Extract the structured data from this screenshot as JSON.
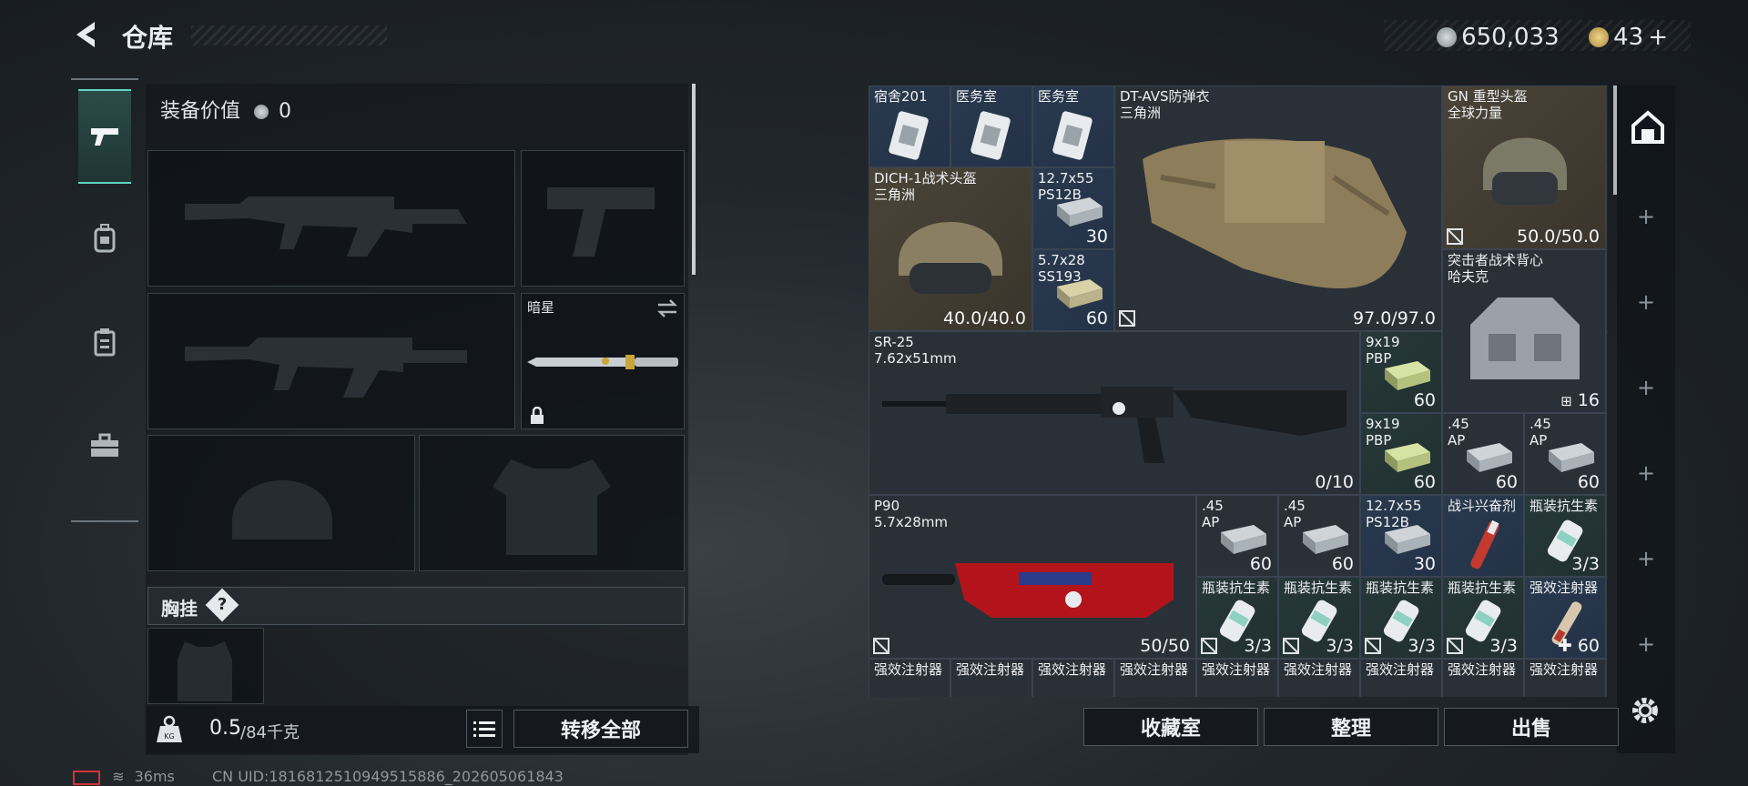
{
  "header": {
    "title": "仓库",
    "currency1_value": "650,033",
    "currency2_value": "43",
    "currency2_add": "+"
  },
  "left_nav": {
    "items": [
      "weapon-icon",
      "backpack-icon",
      "clipboard-icon",
      "toolbox-icon"
    ],
    "active": 0
  },
  "equipment": {
    "value_label": "装备价值",
    "value": "0",
    "melee_name": "暗星",
    "chest_label": "胸挂",
    "chest_help": "?",
    "weight_current": "0.5",
    "weight_max": "/84千克",
    "transfer_all": "转移全部"
  },
  "grid": {
    "items": [
      {
        "name": "宿舍201",
        "sub": "",
        "qty": ""
      },
      {
        "name": "医务室",
        "sub": "",
        "qty": ""
      },
      {
        "name": "医务室",
        "sub": "",
        "qty": ""
      },
      {
        "name": "DT-AVS防弹衣",
        "sub": "三角洲",
        "qty": "97.0/97.0"
      },
      {
        "name": "GN 重型头盔",
        "sub": "全球力量",
        "qty": "50.0/50.0"
      },
      {
        "name": "DICH-1战术头盔",
        "sub": "三角洲",
        "qty": "40.0/40.0"
      },
      {
        "name": "12.7x55",
        "sub": "PS12B",
        "qty": "30"
      },
      {
        "name": "5.7x28",
        "sub": "SS193",
        "qty": "60"
      },
      {
        "name": "突击者战术背心",
        "sub": "哈夫克",
        "qty": "16"
      },
      {
        "name": "SR-25",
        "sub": "7.62x51mm",
        "qty": "0/10"
      },
      {
        "name": "9x19",
        "sub": "PBP",
        "qty": "60"
      },
      {
        "name": "9x19",
        "sub": "PBP",
        "qty": "60"
      },
      {
        "name": ".45",
        "sub": "AP",
        "qty": "60"
      },
      {
        "name": ".45",
        "sub": "AP",
        "qty": "60"
      },
      {
        "name": "P90",
        "sub": "5.7x28mm",
        "qty": "50/50"
      },
      {
        "name": ".45",
        "sub": "AP",
        "qty": "60"
      },
      {
        "name": ".45",
        "sub": "AP",
        "qty": "60"
      },
      {
        "name": "12.7x55",
        "sub": "PS12B",
        "qty": "30"
      },
      {
        "name": "战斗兴奋剂",
        "sub": "",
        "qty": ""
      },
      {
        "name": "瓶装抗生素",
        "sub": "",
        "qty": "3/3"
      },
      {
        "name": "瓶装抗生素",
        "sub": "",
        "qty": "3/3"
      },
      {
        "name": "瓶装抗生素",
        "sub": "",
        "qty": "3/3"
      },
      {
        "name": "瓶装抗生素",
        "sub": "",
        "qty": "3/3"
      },
      {
        "name": "瓶装抗生素",
        "sub": "",
        "qty": "3/3"
      },
      {
        "name": "强效注射器",
        "sub": "",
        "qty": "60"
      },
      {
        "name": "强效注射器",
        "sub": "",
        "qty": ""
      },
      {
        "name": "强效注射器",
        "sub": "",
        "qty": ""
      },
      {
        "name": "强效注射器",
        "sub": "",
        "qty": ""
      },
      {
        "name": "强效注射器",
        "sub": "",
        "qty": ""
      },
      {
        "name": "强效注射器",
        "sub": "",
        "qty": ""
      },
      {
        "name": "强效注射器",
        "sub": "",
        "qty": ""
      },
      {
        "name": "强效注射器",
        "sub": "",
        "qty": ""
      },
      {
        "name": "强效注射器",
        "sub": "",
        "qty": ""
      },
      {
        "name": "强效注射器",
        "sub": "",
        "qty": ""
      }
    ]
  },
  "actions": {
    "collection": "收藏室",
    "organize": "整理",
    "sell": "出售"
  },
  "status_bar": {
    "ping": "36ms",
    "uid": "CN UID:1816812510949515886_202605061843"
  },
  "colors": {
    "accent": "#5fd6c1",
    "rarity_gold": "#4a4438",
    "rarity_blue": "#2a3a4e",
    "rarity_green": "#27383a"
  }
}
